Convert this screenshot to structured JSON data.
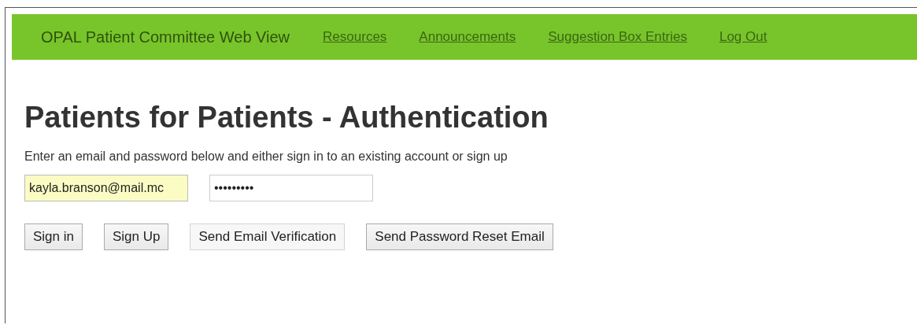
{
  "navbar": {
    "title": "OPAL Patient Committee Web View",
    "links": [
      "Resources",
      "Announcements",
      "Suggestion Box Entries",
      "Log Out"
    ]
  },
  "heading": "Patients for Patients - Authentication",
  "instructions": "Enter an email and password below and either sign in to an existing account or sign up",
  "email_field": {
    "value": "kayla.branson@mail.mc",
    "autofilled": true
  },
  "password_field": {
    "value": "•••••••••"
  },
  "buttons": [
    {
      "label": "Sign in",
      "disabled": false
    },
    {
      "label": "Sign Up",
      "disabled": false
    },
    {
      "label": "Send Email Verification",
      "disabled": true
    },
    {
      "label": "Send Password Reset Email",
      "disabled": false
    }
  ]
}
